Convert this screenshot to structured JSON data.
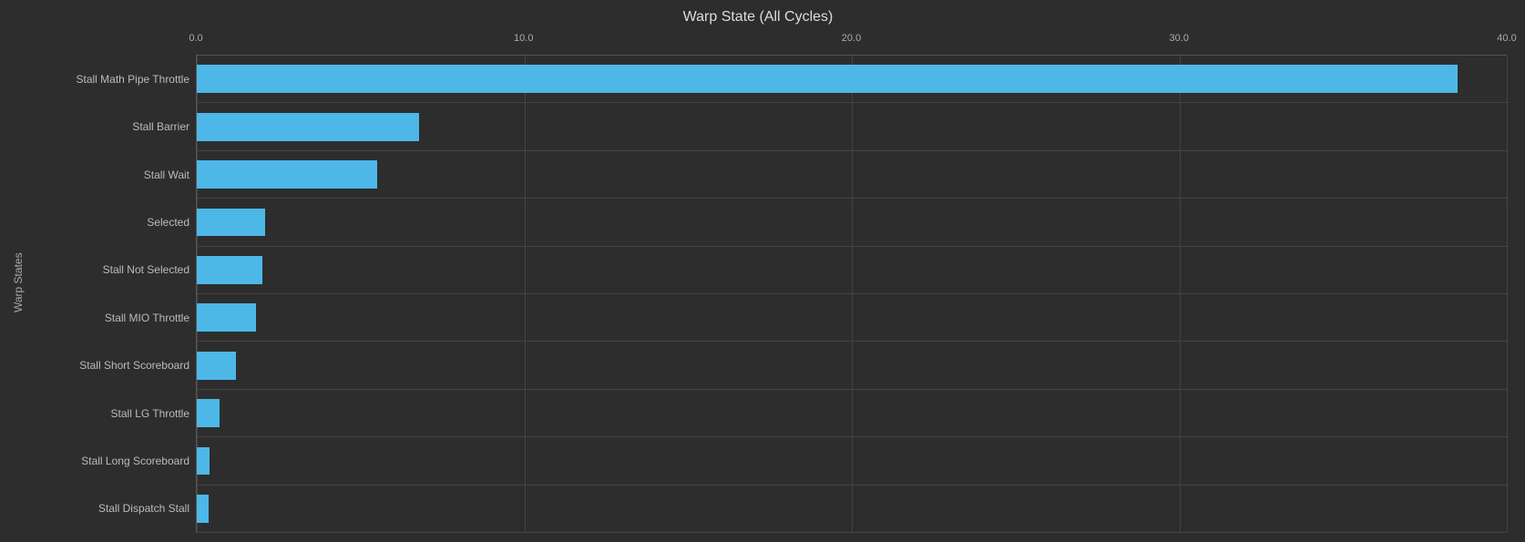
{
  "chart": {
    "title": "Warp State (All Cycles)",
    "y_axis_label": "Warp States",
    "x_axis": {
      "min": 0,
      "max": 40,
      "ticks": [
        {
          "value": 0.0,
          "label": "0.0"
        },
        {
          "value": 10.0,
          "label": "10.0"
        },
        {
          "value": 20.0,
          "label": "20.0"
        },
        {
          "value": 30.0,
          "label": "30.0"
        },
        {
          "value": 40.0,
          "label": "40.0"
        }
      ]
    },
    "bars": [
      {
        "label": "Stall Math Pipe Throttle",
        "value": 38.5
      },
      {
        "label": "Stall Barrier",
        "value": 6.8
      },
      {
        "label": "Stall Wait",
        "value": 5.5
      },
      {
        "label": "Selected",
        "value": 2.1
      },
      {
        "label": "Stall Not Selected",
        "value": 2.0
      },
      {
        "label": "Stall MIO Throttle",
        "value": 1.8
      },
      {
        "label": "Stall Short Scoreboard",
        "value": 1.2
      },
      {
        "label": "Stall LG Throttle",
        "value": 0.7
      },
      {
        "label": "Stall Long Scoreboard",
        "value": 0.4
      },
      {
        "label": "Stall Dispatch Stall",
        "value": 0.35
      }
    ],
    "bar_color": "#4db8e8",
    "grid_color": "#444444",
    "bg_color": "#2d2d2d"
  }
}
